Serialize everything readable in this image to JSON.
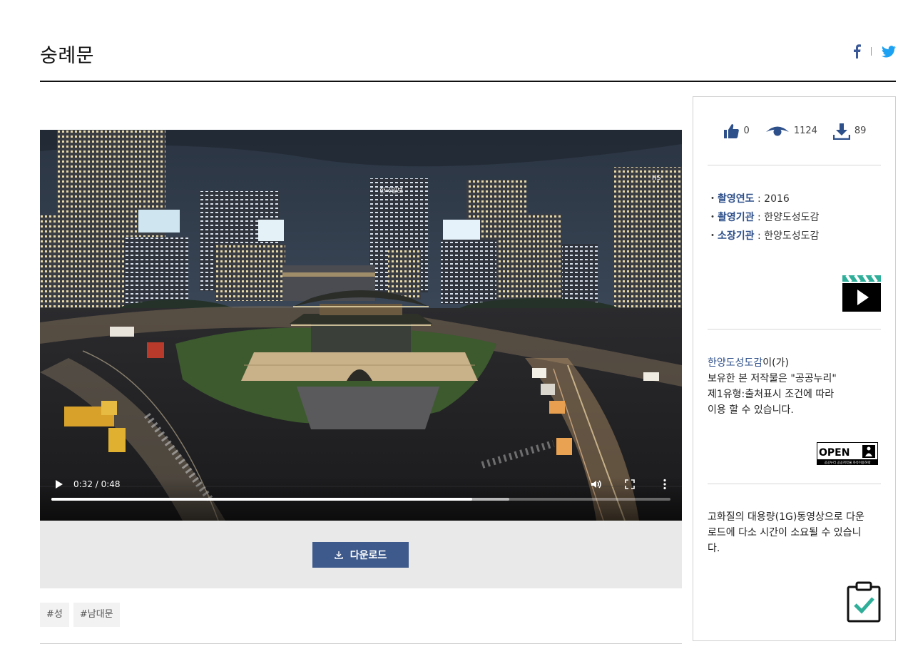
{
  "page": {
    "title": "숭례문"
  },
  "share": {
    "facebook_icon": "facebook-icon",
    "twitter_icon": "twitter-icon"
  },
  "video": {
    "current_time": "0:32",
    "duration": "0:48",
    "time_label": "0:32 / 0:48",
    "played_fraction": 0.68,
    "buffered_fraction": 0.74,
    "scene_label_1": "한국일보",
    "scene_label_2": "HS"
  },
  "download": {
    "label": "다운로드"
  },
  "tags": [
    "#성",
    "#남대문"
  ],
  "stats": {
    "likes": "0",
    "views": "1124",
    "downloads": "89"
  },
  "meta": {
    "items": [
      {
        "key": "촬영연도",
        "value": "2016"
      },
      {
        "key": "촬영기관",
        "value": "한양도성도감"
      },
      {
        "key": "소장기관",
        "value": "한양도성도감"
      }
    ]
  },
  "license": {
    "org": "한양도성도감",
    "suffix": "이(가)",
    "line2": "보유한 본 저작물은 \"공공누리\"",
    "line3": "제1유형:출처표시 조건에 따라",
    "line4": "이용 할 수 있습니다.",
    "badge_text": "OPEN",
    "badge_sub": "공공누리  공공저작물 자유이용허락"
  },
  "notice": {
    "line1": "고화질의 대용량(1G)동영상으로 다운",
    "line2": "로드에 다소 시간이 소요될 수 있습니",
    "line3": "다."
  },
  "colors": {
    "accent": "#3e5a8c",
    "twitter": "#1da1f2",
    "facebook": "#3b5998",
    "label": "#2d4f8a"
  }
}
